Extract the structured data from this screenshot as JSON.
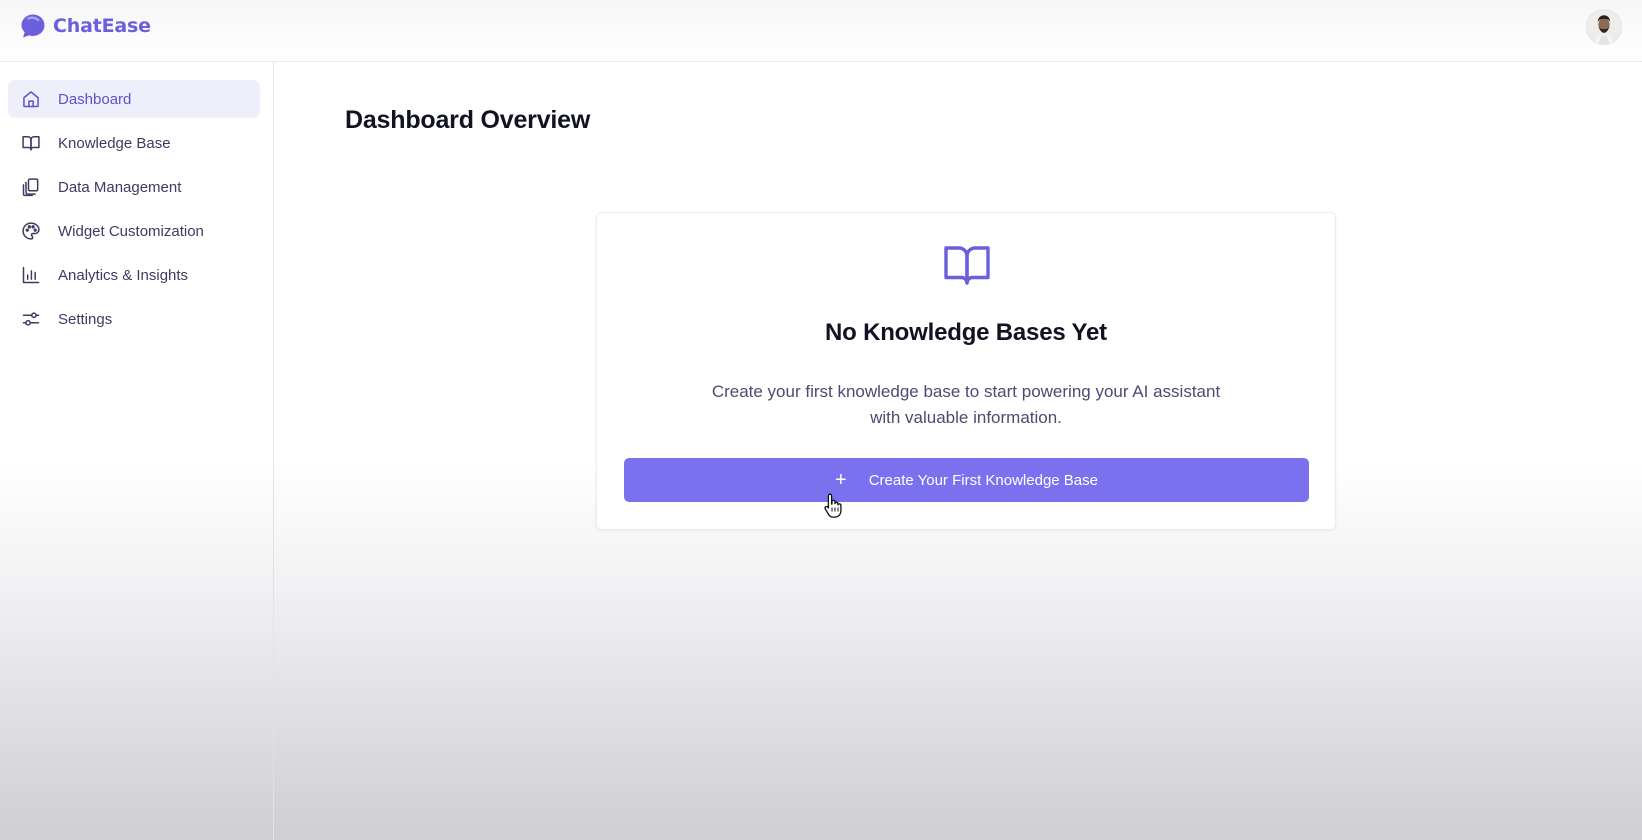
{
  "app": {
    "brand_name": "ChatEase",
    "brand_icon": "chat-bubble-icon",
    "accent_color": "#7b70ee"
  },
  "header": {
    "avatar": "user-avatar"
  },
  "sidebar": {
    "items": [
      {
        "label": "Dashboard",
        "icon": "home-icon",
        "active": true
      },
      {
        "label": "Knowledge Base",
        "icon": "book-open-icon",
        "active": false
      },
      {
        "label": "Data Management",
        "icon": "files-icon",
        "active": false
      },
      {
        "label": "Widget Customization",
        "icon": "palette-icon",
        "active": false
      },
      {
        "label": "Analytics & Insights",
        "icon": "bar-chart-icon",
        "active": false
      },
      {
        "label": "Settings",
        "icon": "sliders-icon",
        "active": false
      }
    ]
  },
  "main": {
    "title": "Dashboard Overview",
    "empty_state": {
      "icon": "book-open-icon",
      "title": "No Knowledge Bases Yet",
      "description": "Create your first knowledge base to start powering your AI assistant with valuable information.",
      "button_label": "Create Your First Knowledge Base",
      "button_icon": "plus-icon"
    }
  }
}
